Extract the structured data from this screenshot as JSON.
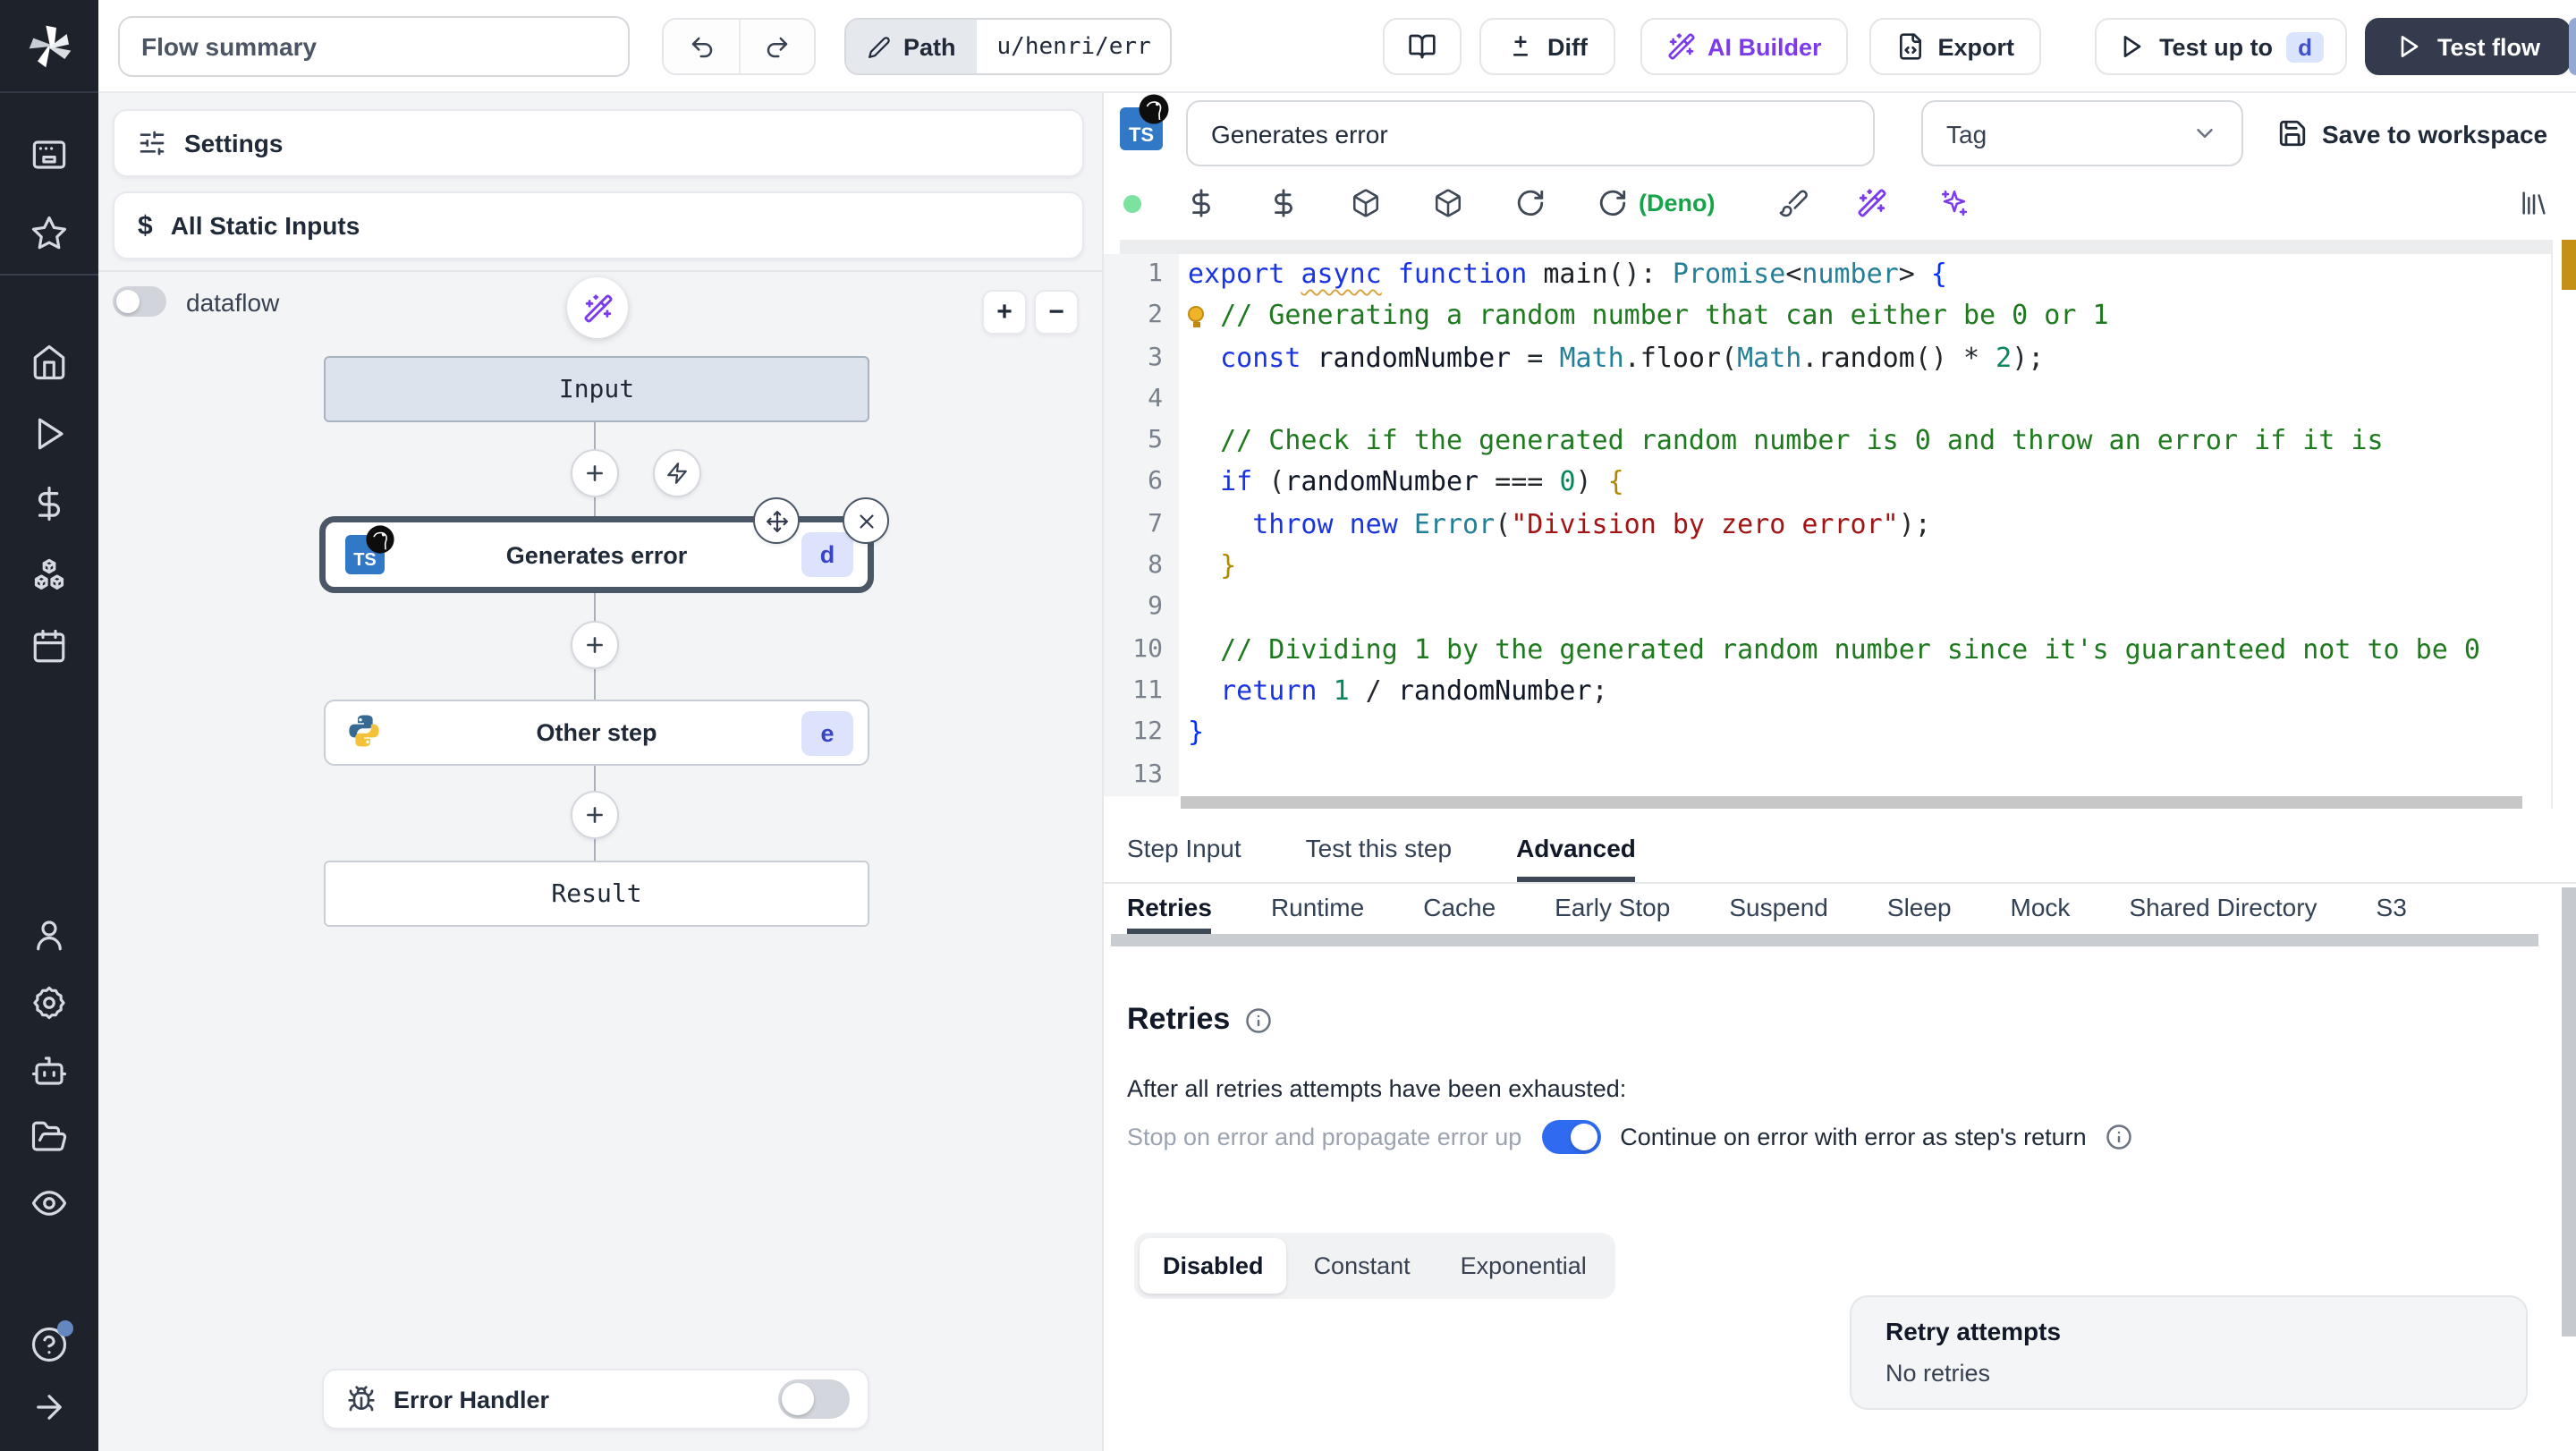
{
  "colors": {
    "accent_blue": "#2f6bf0",
    "ai_purple": "#7c3aed",
    "deno_green": "#16a34a",
    "badge_bg": "#dde3fc",
    "badge_text": "#3a45c3",
    "dark_button": "#333b4d",
    "status_green": "#7ce2a0",
    "warning_marker": "#c49116"
  },
  "topbar": {
    "flow_summary": "Flow summary",
    "path_label": "Path",
    "path_value": "u/henri/err",
    "diff_label": "Diff",
    "ai_builder_label": "AI Builder",
    "export_label": "Export",
    "test_up_to_label": "Test up to",
    "test_up_to_badge": "d",
    "test_flow_label": "Test flow"
  },
  "sidebar": {
    "items": [
      {
        "name": "apps",
        "icon": "app-window"
      },
      {
        "name": "favorites",
        "icon": "star"
      },
      {
        "name": "home",
        "icon": "home"
      },
      {
        "name": "runs",
        "icon": "play"
      },
      {
        "name": "variables",
        "icon": "dollar"
      },
      {
        "name": "resources",
        "icon": "boxes"
      },
      {
        "name": "schedules",
        "icon": "calendar"
      },
      {
        "name": "account",
        "icon": "user"
      },
      {
        "name": "settings",
        "icon": "gear"
      },
      {
        "name": "assistant",
        "icon": "bot"
      },
      {
        "name": "folders",
        "icon": "folder"
      },
      {
        "name": "audit",
        "icon": "eye"
      },
      {
        "name": "help",
        "icon": "help"
      },
      {
        "name": "collapse",
        "icon": "arrow-right"
      }
    ]
  },
  "flow": {
    "settings_label": "Settings",
    "static_inputs_label": "All Static Inputs",
    "dataflow_label": "dataflow",
    "zoom_in_label": "+",
    "zoom_out_label": "−",
    "input_node": "Input",
    "steps": [
      {
        "id": "d",
        "title": "Generates error",
        "lang": "deno-typescript"
      },
      {
        "id": "e",
        "title": "Other step",
        "lang": "python"
      }
    ],
    "result_node": "Result",
    "error_handler_label": "Error Handler"
  },
  "editor": {
    "step_name": "Generates error",
    "tag_placeholder": "Tag",
    "save_label": "Save to workspace",
    "runtime_label": "(Deno)",
    "code_lines": [
      {
        "tokens": [
          [
            "k",
            "export "
          ],
          [
            "ka",
            "async"
          ],
          [
            "k",
            " function "
          ],
          [
            "f",
            "main"
          ],
          [
            "p",
            "(): "
          ],
          [
            "t",
            "Promise"
          ],
          [
            "p",
            "<"
          ],
          [
            "t",
            "number"
          ],
          [
            "p",
            "> "
          ],
          [
            "b1",
            "{"
          ]
        ]
      },
      {
        "bulb": true,
        "tokens": [
          [
            "p",
            "  "
          ],
          [
            "c",
            "// Generating a random number that can either be 0 or 1"
          ]
        ]
      },
      {
        "tokens": [
          [
            "p",
            "  "
          ],
          [
            "k",
            "const "
          ],
          [
            "v",
            "randomNumber"
          ],
          [
            "p",
            " = "
          ],
          [
            "t",
            "Math"
          ],
          [
            "p",
            "."
          ],
          [
            "f",
            "floor"
          ],
          [
            "p",
            "("
          ],
          [
            "t",
            "Math"
          ],
          [
            "p",
            "."
          ],
          [
            "f",
            "random"
          ],
          [
            "p",
            "() * "
          ],
          [
            "n",
            "2"
          ],
          [
            "p",
            ");"
          ]
        ]
      },
      {
        "tokens": []
      },
      {
        "tokens": [
          [
            "p",
            "  "
          ],
          [
            "c",
            "// Check if the generated random number is 0 and throw an error if it is"
          ]
        ]
      },
      {
        "tokens": [
          [
            "p",
            "  "
          ],
          [
            "k",
            "if "
          ],
          [
            "p",
            "("
          ],
          [
            "v",
            "randomNumber"
          ],
          [
            "p",
            " === "
          ],
          [
            "n",
            "0"
          ],
          [
            "p",
            ") "
          ],
          [
            "b2",
            "{"
          ]
        ]
      },
      {
        "tokens": [
          [
            "p",
            "    "
          ],
          [
            "k",
            "throw new "
          ],
          [
            "t",
            "Error"
          ],
          [
            "p",
            "("
          ],
          [
            "s",
            "\"Division by zero error\""
          ],
          [
            "p",
            ");"
          ]
        ]
      },
      {
        "tokens": [
          [
            "p",
            "  "
          ],
          [
            "b2",
            "}"
          ]
        ]
      },
      {
        "tokens": []
      },
      {
        "tokens": [
          [
            "p",
            "  "
          ],
          [
            "c",
            "// Dividing 1 by the generated random number since it's guaranteed not to be 0"
          ]
        ]
      },
      {
        "tokens": [
          [
            "p",
            "  "
          ],
          [
            "k",
            "return "
          ],
          [
            "n",
            "1"
          ],
          [
            "p",
            " / "
          ],
          [
            "v",
            "randomNumber"
          ],
          [
            "p",
            ";"
          ]
        ]
      },
      {
        "tokens": [
          [
            "b1",
            "}"
          ]
        ]
      },
      {
        "tokens": []
      }
    ]
  },
  "panel": {
    "tabs": [
      "Step Input",
      "Test this step",
      "Advanced"
    ],
    "active_tab": "Advanced",
    "subtabs": [
      "Retries",
      "Runtime",
      "Cache",
      "Early Stop",
      "Suspend",
      "Sleep",
      "Mock",
      "Shared Directory",
      "S3"
    ],
    "active_subtab": "Retries"
  },
  "retries": {
    "heading": "Retries",
    "exhausted_label": "After all retries attempts have been exhausted:",
    "stop_label": "Stop on error and propagate error up",
    "continue_label": "Continue on error with error as step's return",
    "continue_enabled": true,
    "modes": [
      "Disabled",
      "Constant",
      "Exponential"
    ],
    "active_mode": "Disabled",
    "attempts_title": "Retry attempts",
    "attempts_value": "No retries"
  }
}
